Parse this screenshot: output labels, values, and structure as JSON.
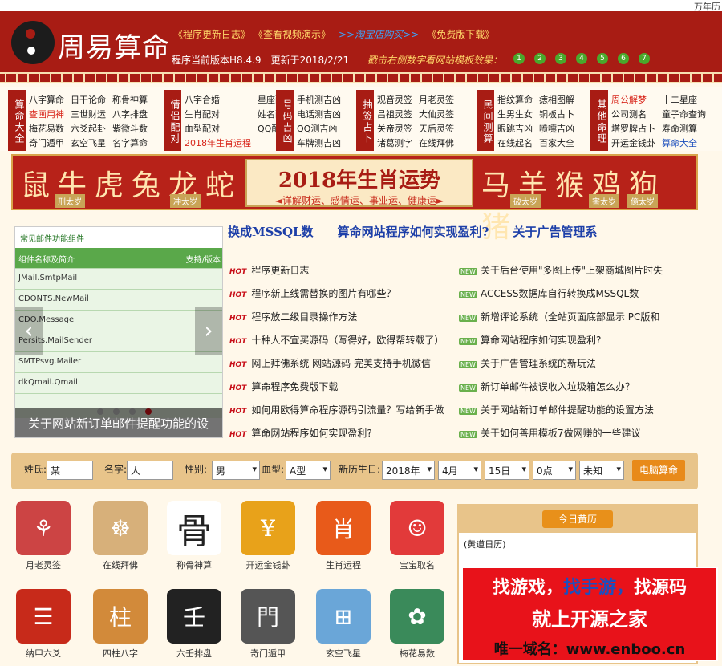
{
  "topbar": {
    "wannianli": "万年历"
  },
  "header": {
    "title": "周易算命",
    "links": [
      "《程序更新日志》",
      "《查看视频演示》",
      ">>淘宝店购买>>",
      "《免费版下载》"
    ],
    "version": "程序当前版本H8.4.9",
    "updated": "更新于2018/2/21",
    "demo_label": "戳击右侧数字看网站模板效果：",
    "demo_numbers": [
      "1",
      "2",
      "3",
      "4",
      "5",
      "6",
      "7"
    ]
  },
  "categories": [
    {
      "side": "算命大全",
      "items": [
        "八字算命",
        "日干论命",
        "称骨神算",
        "查画用神",
        "三世财运",
        "八字排盘",
        "梅花易数",
        "六爻起卦",
        "紫微斗数",
        "奇门遁甲",
        "玄空飞星",
        "名字算命"
      ]
    },
    {
      "side": "情侣配对",
      "items": [
        "八字合婚",
        "星座配对",
        "生肖配对",
        "姓名配对",
        "血型配对",
        "QQ配对",
        "2018年生肖运程"
      ]
    },
    {
      "side": "号码吉凶",
      "items": [
        "手机测吉凶",
        "电话测吉凶",
        "QQ测吉凶",
        "车牌测吉凶"
      ]
    },
    {
      "side": "抽签占卜",
      "items": [
        "观音灵签",
        "月老灵签",
        "吕祖灵签",
        "大仙灵签",
        "关帝灵签",
        "天后灵签",
        "诸葛测字",
        "在线拜佛"
      ]
    },
    {
      "side": "民间测算",
      "items": [
        "指纹算命",
        "痣相图解",
        "生男生女",
        "铜板占卜",
        "眼跳吉凶",
        "喷嚏吉凶",
        "在线起名",
        "百家大全"
      ]
    },
    {
      "side": "其他命理",
      "items": [
        "周公解梦",
        "十二星座",
        "公司测名",
        "童子命查询",
        "塔罗牌占卜",
        "寿命测算",
        "开运金钱卦",
        "算命大全"
      ]
    }
  ],
  "banner": {
    "left": "鼠牛虎兔龙蛇",
    "right": "马羊猴鸡狗猪",
    "title": "2018年生肖运势",
    "subtitle": "◄详解财运、感情运、事业运、健康运►",
    "tags": [
      "刑太岁",
      "冲太岁",
      "破太岁",
      "害太岁",
      "億太岁"
    ]
  },
  "slider": {
    "title": "常见邮件功能组件",
    "header_left": "组件名称及简介",
    "header_right": "支持/版本",
    "rows": [
      "JMail.SmtpMail",
      "CDONTS.NewMail",
      "CDO.Message",
      "Persits.MailSender",
      "SMTPsvg.Mailer",
      "dkQmail.Qmail"
    ],
    "caption": "关于网站新订单邮件提醒功能的设"
  },
  "news_head": [
    "换成MSSQL数",
    "算命网站程序如何实现盈利?",
    "关于广告管理系"
  ],
  "news_left": [
    "程序更新日志",
    "程序新上线需替换的图片有哪些？",
    "程序放二级目录操作方法",
    "十种人不宜买源码（写得好，欧得帮转载了）",
    "网上拜佛系统 网站源码 完美支持手机微信",
    "算命程序免费版下载",
    "如何用欧得算命程序源码引流量？写给新手做",
    "算命网站程序如何实现盈利?"
  ],
  "news_right": [
    "关于后台使用\"多图上传\"上架商城图片时失",
    "ACCESS数据库自行转换成MSSQL数",
    "新增评论系统（全站页面底部显示 PC版和",
    "算命网站程序如何实现盈利?",
    "关于广告管理系统的新玩法",
    "新订单邮件被误收入垃圾箱怎么办？",
    "关于网站新订单邮件提醒功能的设置方法",
    "关于如何善用模板7做网赚的一些建议"
  ],
  "form": {
    "surname_label": "姓氏:",
    "surname_val": "某",
    "name_label": "名字:",
    "name_val": "人",
    "gender_label": "性别:",
    "gender_val": "男",
    "blood_label": "血型:",
    "blood_val": "A型",
    "birth_label": "新历生日:",
    "year": "2018年",
    "month": "4月",
    "day": "15日",
    "hour": "0点",
    "min": "未知",
    "submit": "电脑算命"
  },
  "apps": [
    {
      "label": "月老灵签",
      "glyph": "⚘",
      "color": "#c44"
    },
    {
      "label": "在线拜佛",
      "glyph": "☸",
      "color": "#d7b07a"
    },
    {
      "label": "称骨神算",
      "glyph": "骨",
      "color": "#222"
    },
    {
      "label": "开运金钱卦",
      "glyph": "¥",
      "color": "#e8a21a"
    },
    {
      "label": "生肖运程",
      "glyph": "肖",
      "color": "#e85a1a"
    },
    {
      "label": "宝宝取名",
      "glyph": "☺",
      "color": "#e23a3a"
    },
    {
      "label": "纳甲六爻",
      "glyph": "☰",
      "color": "#c72a1a"
    },
    {
      "label": "四柱八字",
      "glyph": "柱",
      "color": "#d28a3a"
    },
    {
      "label": "六壬排盘",
      "glyph": "壬",
      "color": "#222"
    },
    {
      "label": "奇门遁甲",
      "glyph": "門",
      "color": "#555"
    },
    {
      "label": "玄空飞星",
      "glyph": "⊞",
      "color": "#6aa6d8"
    },
    {
      "label": "梅花易数",
      "glyph": "✿",
      "color": "#3a8a5a"
    }
  ],
  "today": {
    "title": "今日黄历",
    "sub": "(黄道日历)"
  },
  "ad": {
    "l1a": "找游戏，",
    "l1b": "找手游，",
    "l1c": "找源码",
    "l2": "就上开源之家",
    "l3": "唯一域名：www.enboo.cn"
  }
}
